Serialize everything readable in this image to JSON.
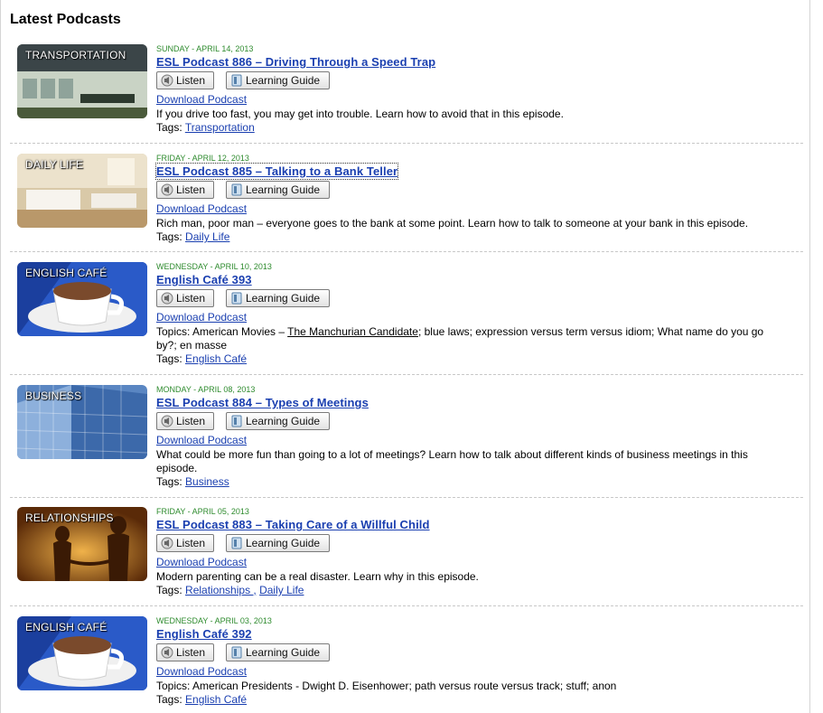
{
  "page": {
    "title": "Latest Podcasts"
  },
  "buttons": {
    "listen": "Listen",
    "guide": "Learning Guide",
    "download": "Download Podcast",
    "tags_label": "Tags:"
  },
  "episodes": [
    {
      "category": "TRANSPORTATION",
      "date": "SUNDAY - APRIL 14, 2013",
      "title": "ESL Podcast 886 – Driving Through a Speed Trap",
      "description": "If you drive too fast, you may get into trouble. Learn how to avoid that in this episode.",
      "tags": [
        "Transportation"
      ]
    },
    {
      "category": "DAILY LIFE",
      "date": "FRIDAY - APRIL 12, 2013",
      "title": "ESL Podcast 885 – Talking to a Bank Teller",
      "description": "Rich man, poor man – everyone goes to the bank at some point. Learn how to talk to someone at your bank in this episode.",
      "tags": [
        "Daily Life"
      ]
    },
    {
      "category": "ENGLISH CAFÉ",
      "date": "WEDNESDAY - APRIL 10, 2013",
      "title": "English Café 393",
      "description_prefix": "Topics: American Movies – ",
      "description_link": "The Manchurian Candidate",
      "description_suffix": "; blue laws; expression versus term versus idiom; What name do you go by?; en masse",
      "tags": [
        "English Café"
      ]
    },
    {
      "category": "BUSINESS",
      "date": "MONDAY - APRIL 08, 2013",
      "title": "ESL Podcast 884 – Types of Meetings",
      "description": "What could be more fun than going to a lot of meetings? Learn how to talk about different kinds of business meetings in this episode.",
      "tags": [
        "Business"
      ]
    },
    {
      "category": "RELATIONSHIPS",
      "date": "FRIDAY - APRIL 05, 2013",
      "title": "ESL Podcast 883 – Taking Care of a Willful Child",
      "description": "Modern parenting can be a real disaster. Learn why in this episode.",
      "tags": [
        "Relationships ,",
        "Daily Life"
      ]
    },
    {
      "category": "ENGLISH CAFÉ",
      "date": "WEDNESDAY - APRIL 03, 2013",
      "title": "English Café 392",
      "description": "Topics: American Presidents - Dwight D. Eisenhower; path versus route versus track; stuff; anon",
      "tags": [
        "English Café"
      ]
    }
  ],
  "colors": {
    "link": "#1a3fb0",
    "date": "#2e8b2e",
    "divider": "#c8c8c8"
  }
}
